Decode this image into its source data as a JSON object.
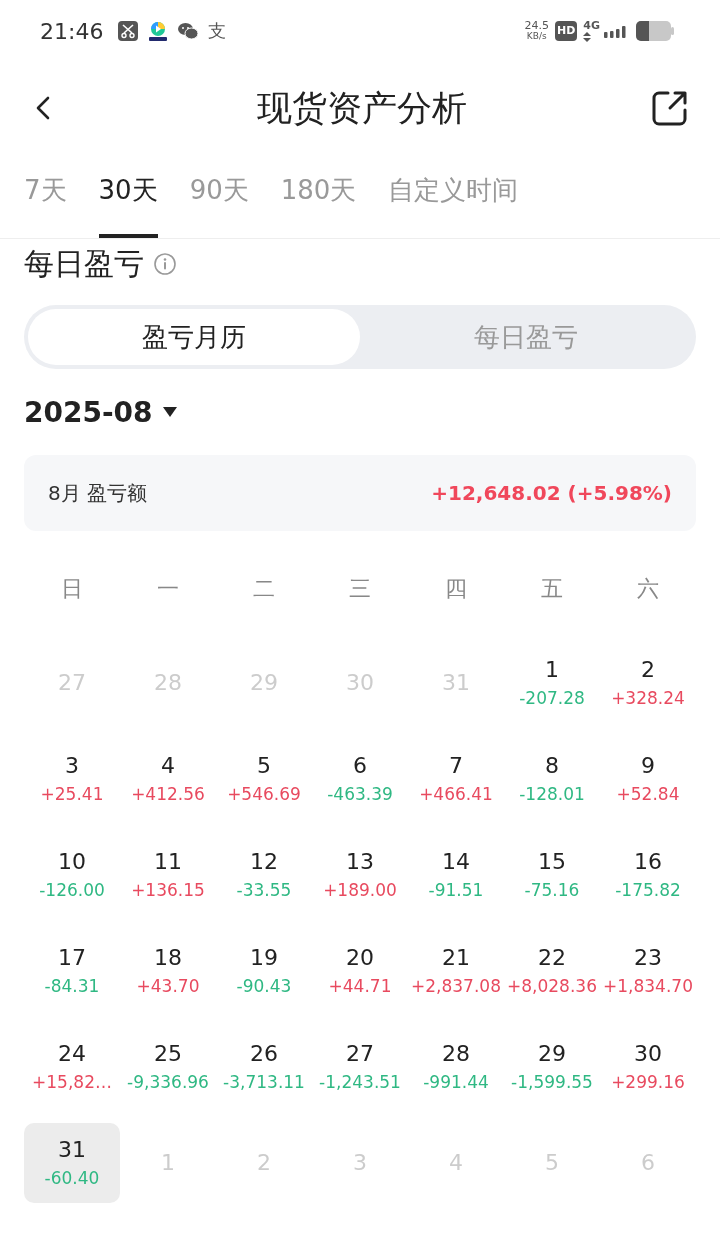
{
  "status_bar": {
    "time": "21:46",
    "notification_glyph": "支",
    "speed_value": "24.5",
    "speed_unit": "KB/s",
    "hd_badge": "HD",
    "network_type": "4G"
  },
  "header": {
    "title": "现货资产分析"
  },
  "tabs": [
    {
      "label": "7天",
      "selected": false
    },
    {
      "label": "30天",
      "selected": true
    },
    {
      "label": "90天",
      "selected": false
    },
    {
      "label": "180天",
      "selected": false
    },
    {
      "label": "自定义时间",
      "selected": false
    }
  ],
  "section": {
    "title": "每日盈亏"
  },
  "view_switch": [
    {
      "label": "盈亏月历",
      "selected": true
    },
    {
      "label": "每日盈亏",
      "selected": false
    }
  ],
  "month_picker": {
    "value": "2025-08"
  },
  "summary": {
    "label": "8月 盈亏额",
    "value": "+12,648.02 (+5.98%)",
    "kind": "gain"
  },
  "calendar": {
    "weekdays": [
      "日",
      "一",
      "二",
      "三",
      "四",
      "五",
      "六"
    ],
    "days": [
      {
        "day": "27",
        "in_month": false,
        "selected": false
      },
      {
        "day": "28",
        "in_month": false,
        "selected": false
      },
      {
        "day": "29",
        "in_month": false,
        "selected": false
      },
      {
        "day": "30",
        "in_month": false,
        "selected": false
      },
      {
        "day": "31",
        "in_month": false,
        "selected": false
      },
      {
        "day": "1",
        "in_month": true,
        "selected": false,
        "pnl": "-207.28",
        "kind": "loss"
      },
      {
        "day": "2",
        "in_month": true,
        "selected": false,
        "pnl": "+328.24",
        "kind": "gain"
      },
      {
        "day": "3",
        "in_month": true,
        "selected": false,
        "pnl": "+25.41",
        "kind": "gain"
      },
      {
        "day": "4",
        "in_month": true,
        "selected": false,
        "pnl": "+412.56",
        "kind": "gain"
      },
      {
        "day": "5",
        "in_month": true,
        "selected": false,
        "pnl": "+546.69",
        "kind": "gain"
      },
      {
        "day": "6",
        "in_month": true,
        "selected": false,
        "pnl": "-463.39",
        "kind": "loss"
      },
      {
        "day": "7",
        "in_month": true,
        "selected": false,
        "pnl": "+466.41",
        "kind": "gain"
      },
      {
        "day": "8",
        "in_month": true,
        "selected": false,
        "pnl": "-128.01",
        "kind": "loss"
      },
      {
        "day": "9",
        "in_month": true,
        "selected": false,
        "pnl": "+52.84",
        "kind": "gain"
      },
      {
        "day": "10",
        "in_month": true,
        "selected": false,
        "pnl": "-126.00",
        "kind": "loss"
      },
      {
        "day": "11",
        "in_month": true,
        "selected": false,
        "pnl": "+136.15",
        "kind": "gain"
      },
      {
        "day": "12",
        "in_month": true,
        "selected": false,
        "pnl": "-33.55",
        "kind": "loss"
      },
      {
        "day": "13",
        "in_month": true,
        "selected": false,
        "pnl": "+189.00",
        "kind": "gain"
      },
      {
        "day": "14",
        "in_month": true,
        "selected": false,
        "pnl": "-91.51",
        "kind": "loss"
      },
      {
        "day": "15",
        "in_month": true,
        "selected": false,
        "pnl": "-75.16",
        "kind": "loss"
      },
      {
        "day": "16",
        "in_month": true,
        "selected": false,
        "pnl": "-175.82",
        "kind": "loss"
      },
      {
        "day": "17",
        "in_month": true,
        "selected": false,
        "pnl": "-84.31",
        "kind": "loss"
      },
      {
        "day": "18",
        "in_month": true,
        "selected": false,
        "pnl": "+43.70",
        "kind": "gain"
      },
      {
        "day": "19",
        "in_month": true,
        "selected": false,
        "pnl": "-90.43",
        "kind": "loss"
      },
      {
        "day": "20",
        "in_month": true,
        "selected": false,
        "pnl": "+44.71",
        "kind": "gain"
      },
      {
        "day": "21",
        "in_month": true,
        "selected": false,
        "pnl": "+2,837.08",
        "kind": "gain"
      },
      {
        "day": "22",
        "in_month": true,
        "selected": false,
        "pnl": "+8,028.36",
        "kind": "gain"
      },
      {
        "day": "23",
        "in_month": true,
        "selected": false,
        "pnl": "+1,834.70",
        "kind": "gain"
      },
      {
        "day": "24",
        "in_month": true,
        "selected": false,
        "pnl": "+15,82…",
        "kind": "gain"
      },
      {
        "day": "25",
        "in_month": true,
        "selected": false,
        "pnl": "-9,336.96",
        "kind": "loss"
      },
      {
        "day": "26",
        "in_month": true,
        "selected": false,
        "pnl": "-3,713.11",
        "kind": "loss"
      },
      {
        "day": "27",
        "in_month": true,
        "selected": false,
        "pnl": "-1,243.51",
        "kind": "loss"
      },
      {
        "day": "28",
        "in_month": true,
        "selected": false,
        "pnl": "-991.44",
        "kind": "loss"
      },
      {
        "day": "29",
        "in_month": true,
        "selected": false,
        "pnl": "-1,599.55",
        "kind": "loss"
      },
      {
        "day": "30",
        "in_month": true,
        "selected": false,
        "pnl": "+299.16",
        "kind": "gain"
      },
      {
        "day": "31",
        "in_month": true,
        "selected": true,
        "pnl": "-60.40",
        "kind": "loss"
      },
      {
        "day": "1",
        "in_month": false,
        "selected": false
      },
      {
        "day": "2",
        "in_month": false,
        "selected": false
      },
      {
        "day": "3",
        "in_month": false,
        "selected": false
      },
      {
        "day": "4",
        "in_month": false,
        "selected": false
      },
      {
        "day": "5",
        "in_month": false,
        "selected": false
      },
      {
        "day": "6",
        "in_month": false,
        "selected": false
      }
    ]
  }
}
